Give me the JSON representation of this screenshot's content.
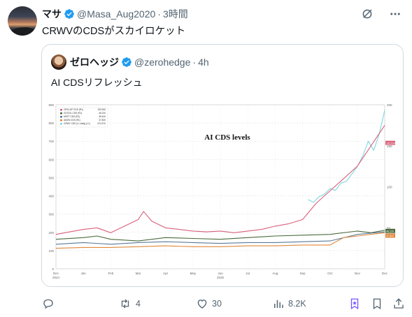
{
  "post": {
    "author_name": "マサ",
    "author_handle": "@Masa_Aug2020",
    "time": "3時間",
    "text": "CRWVのCDSがスカイロケット"
  },
  "quoted": {
    "author_name": "ゼロヘッジ",
    "author_handle": "@zerohedge",
    "time": "4h",
    "text": "AI CDSリフレッシュ"
  },
  "chart_data": {
    "type": "line",
    "title": "AI CDS levels",
    "legend": [
      "ORCLUP CDS (R1)",
      "GOOGL CDS (R1)",
      "MSFT CDS (R1)",
      "AMZN CDS (R1)",
      "CRWV CDS (L1 daily) (L1)"
    ],
    "legend_values": [
      "153.530",
      "46.220",
      "36.400",
      "37.820",
      "674.970"
    ],
    "x_ticks": [
      "Dec 2024",
      "Jan",
      "Feb",
      "Mar",
      "Apr",
      "May",
      "Jun 2025",
      "Jul",
      "Aug",
      "Sep",
      "Oct",
      "Nov",
      "Dec"
    ],
    "y_ticks_left": [
      "900",
      "800",
      "700",
      "600",
      "500",
      "400",
      "300",
      "200",
      "100",
      "0"
    ],
    "y_ticks_right": [
      "200",
      "150",
      "100",
      "50"
    ],
    "series": [
      {
        "name": "CRWV CDS (L1 daily) (L1)",
        "color": "#7fd7e0",
        "x": [
          9.2,
          9.4,
          9.6,
          9.8,
          10.0,
          10.2,
          10.4,
          10.6,
          10.8,
          11.0,
          11.2,
          11.4,
          11.6,
          11.8,
          12.0
        ],
        "values": [
          380,
          365,
          395,
          410,
          440,
          430,
          470,
          480,
          520,
          560,
          620,
          700,
          650,
          740,
          870
        ]
      },
      {
        "name": "ORCLUP CDS (R1)",
        "color": "#d9607a",
        "x": [
          0,
          0.5,
          1,
          1.5,
          2,
          2.5,
          3,
          3.2,
          3.5,
          4,
          4.5,
          5,
          5.5,
          6,
          6.5,
          7,
          7.5,
          8,
          8.5,
          9,
          9.5,
          10,
          10.5,
          11,
          11.5,
          12
        ],
        "values": [
          42,
          45,
          48,
          50,
          44,
          52,
          60,
          70,
          58,
          50,
          48,
          46,
          45,
          46,
          44,
          46,
          48,
          52,
          55,
          60,
          80,
          95,
          110,
          125,
          150,
          175
        ]
      },
      {
        "name": "GOOGL CDS (R1)",
        "color": "#4a6a3c",
        "x": [
          0,
          1,
          1.5,
          2,
          3,
          4,
          5,
          6,
          7,
          8,
          9,
          10,
          11,
          11.5,
          12
        ],
        "values": [
          36,
          38,
          40,
          36,
          34,
          38,
          37,
          36,
          38,
          40,
          41,
          42,
          46,
          44,
          47
        ]
      },
      {
        "name": "MSFT CDS (R1)",
        "color": "#5a7a9a",
        "x": [
          0,
          1,
          2,
          3,
          4,
          5,
          6,
          7,
          8,
          9,
          10,
          11,
          12
        ],
        "values": [
          30,
          32,
          30,
          32,
          33,
          32,
          31,
          32,
          32,
          33,
          34,
          42,
          45
        ]
      },
      {
        "name": "AMZN CDS (R1)",
        "color": "#e0883a",
        "x": [
          0,
          1,
          2,
          3,
          4,
          5,
          6,
          7,
          8,
          9,
          10,
          10.5,
          11,
          12
        ],
        "values": [
          25,
          26,
          26,
          27,
          28,
          27,
          27,
          28,
          28,
          29,
          29,
          38,
          40,
          44
        ]
      }
    ],
    "right_axis_tags": [
      {
        "label": "153.530",
        "color": "#d9607a",
        "value": 153.5
      },
      {
        "label": "46.220",
        "color": "#4a6a3c",
        "value": 46.2
      },
      {
        "label": "37.820",
        "color": "#e0883a",
        "value": 40.5
      }
    ],
    "ylim_left": [
      0,
      900
    ],
    "ylim_right": [
      0,
      200
    ],
    "grid": true,
    "legend_position": "top-left"
  },
  "actions": {
    "reply_count": "",
    "retweet_count": "4",
    "like_count": "30",
    "views_count": "8.2K"
  }
}
